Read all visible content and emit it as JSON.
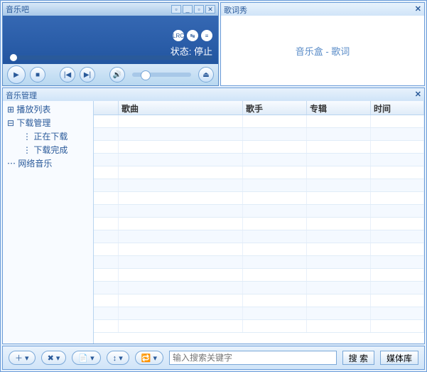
{
  "player": {
    "title": "音乐吧",
    "status_label": "状态:",
    "status_value": "停止",
    "lrc_icons": [
      "LRC",
      "↹",
      "≡"
    ]
  },
  "lyrics": {
    "title": "歌词秀",
    "body": "音乐盒 - 歌词"
  },
  "manager": {
    "title": "音乐管理",
    "tree": {
      "playlist": "播放列表",
      "download": "下载管理",
      "downloading": "正在下载",
      "downloaded": "下载完成",
      "online": "网络音乐"
    },
    "columns": {
      "idx": "",
      "song": "歌曲",
      "artist": "歌手",
      "album": "专辑",
      "time": "时间"
    }
  },
  "bottom": {
    "search_placeholder": "输入搜索关键字",
    "search_btn": "搜 索",
    "media_btn": "媒体库"
  }
}
